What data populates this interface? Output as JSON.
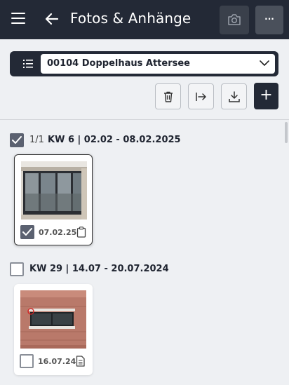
{
  "header": {
    "title": "Fotos & Anhänge",
    "more_label": "···"
  },
  "project": {
    "selected": "00104 Doppelhaus Attersee"
  },
  "toolbar": {
    "add_label": "+"
  },
  "groups": [
    {
      "count": "1/1",
      "label": "KW 6 | 02.02 - 08.02.2025",
      "checked": true,
      "items": [
        {
          "date": "07.02.25",
          "checked": true,
          "icon": "clipboard-icon"
        }
      ]
    },
    {
      "count": "",
      "label": "KW 29 | 14.07 - 20.07.2024",
      "checked": false,
      "items": [
        {
          "date": "16.07.24",
          "checked": false,
          "icon": "document-icon"
        }
      ]
    }
  ],
  "colors": {
    "header_bg": "#232936",
    "checkbox_checked": "#5b6170",
    "page_bg": "#eef0f3"
  }
}
